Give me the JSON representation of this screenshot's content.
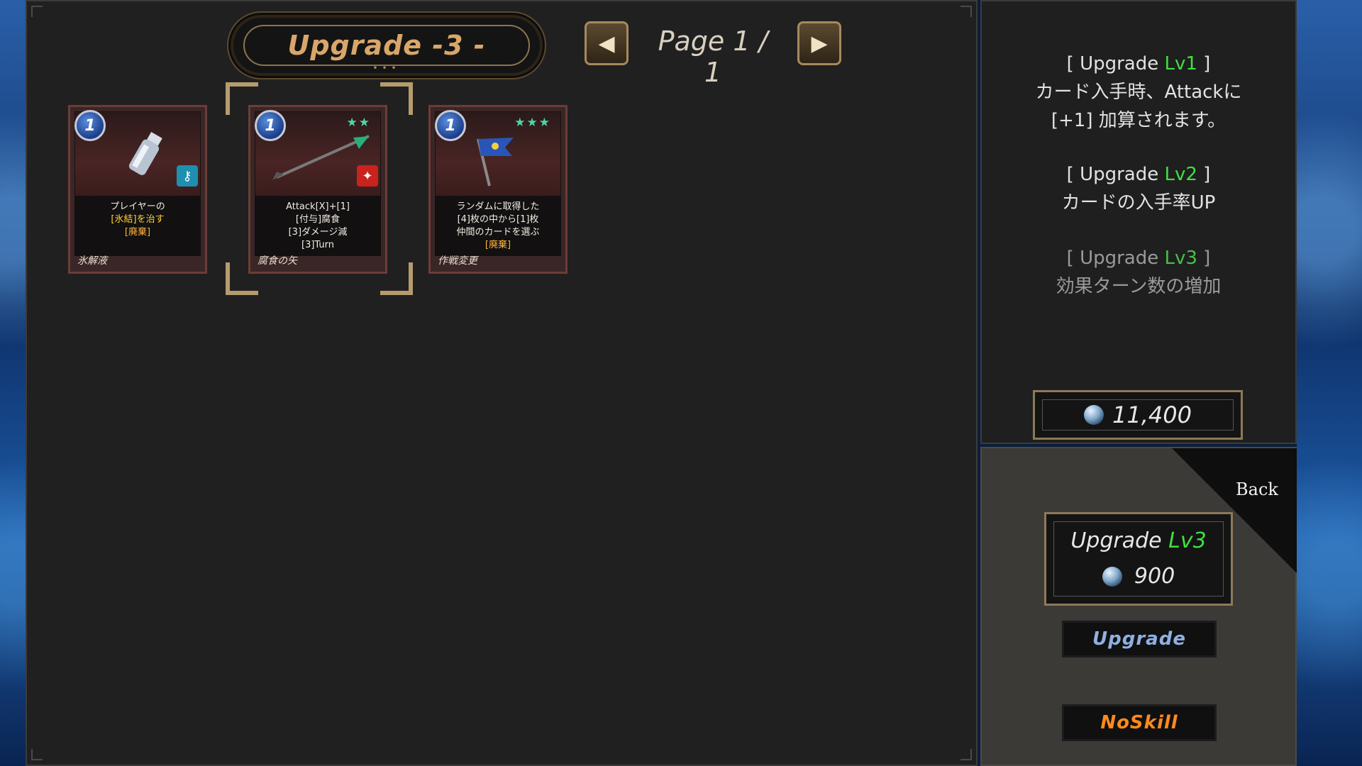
{
  "header": {
    "title": "Upgrade -3 -",
    "page_label": "Page 1 / 1",
    "prev_icon": "◀",
    "next_icon": "▶"
  },
  "cards": [
    {
      "cost": "1",
      "stars": "",
      "lines": [
        "プレイヤーの",
        "[氷結]を治す",
        "[廃棄]"
      ],
      "name": "氷解液",
      "art_icon": "potion-icon",
      "badge_icon": "key-icon",
      "badge_color": "#1f8fb0"
    },
    {
      "cost": "1",
      "stars": "★★",
      "lines": [
        "Attack[X]+[1]",
        "[付与]腐食",
        "[3]ダメージ減",
        "[3]Turn"
      ],
      "name": "腐食の矢",
      "art_icon": "arrow-icon",
      "badge_icon": "attack-icon",
      "badge_color": "#c9231e",
      "selected": true
    },
    {
      "cost": "1",
      "stars": "★★★",
      "lines": [
        "ランダムに取得した",
        "[4]枚の中から[1]枚",
        "仲間のカードを選ぶ",
        "[廃棄]"
      ],
      "name": "作戦変更",
      "art_icon": "flag-icon",
      "badge_icon": "",
      "badge_color": ""
    }
  ],
  "upgrade_info": [
    {
      "head": "Upgrade",
      "lv": "Lv1",
      "body": [
        "カード入手時、Attackに",
        "[+1] 加算されます。"
      ]
    },
    {
      "head": "Upgrade",
      "lv": "Lv2",
      "body": [
        "カードの入手率UP"
      ]
    },
    {
      "head": "Upgrade",
      "lv": "Lv3",
      "body": [
        "効果ターン数の増加"
      ]
    }
  ],
  "currency": {
    "value": "11,400",
    "icon": "orb-icon"
  },
  "back_label": "Back",
  "next_upgrade": {
    "title": "Upgrade",
    "lv": "Lv3",
    "cost": "900"
  },
  "buttons": {
    "upgrade": "Upgrade",
    "noskill": "NoSkill"
  },
  "colors": {
    "level_green": "#3fe03f",
    "highlight_yellow": "#ffd23c",
    "noskill_orange": "#ff8a1c",
    "gold_border": "#8c7a58"
  }
}
